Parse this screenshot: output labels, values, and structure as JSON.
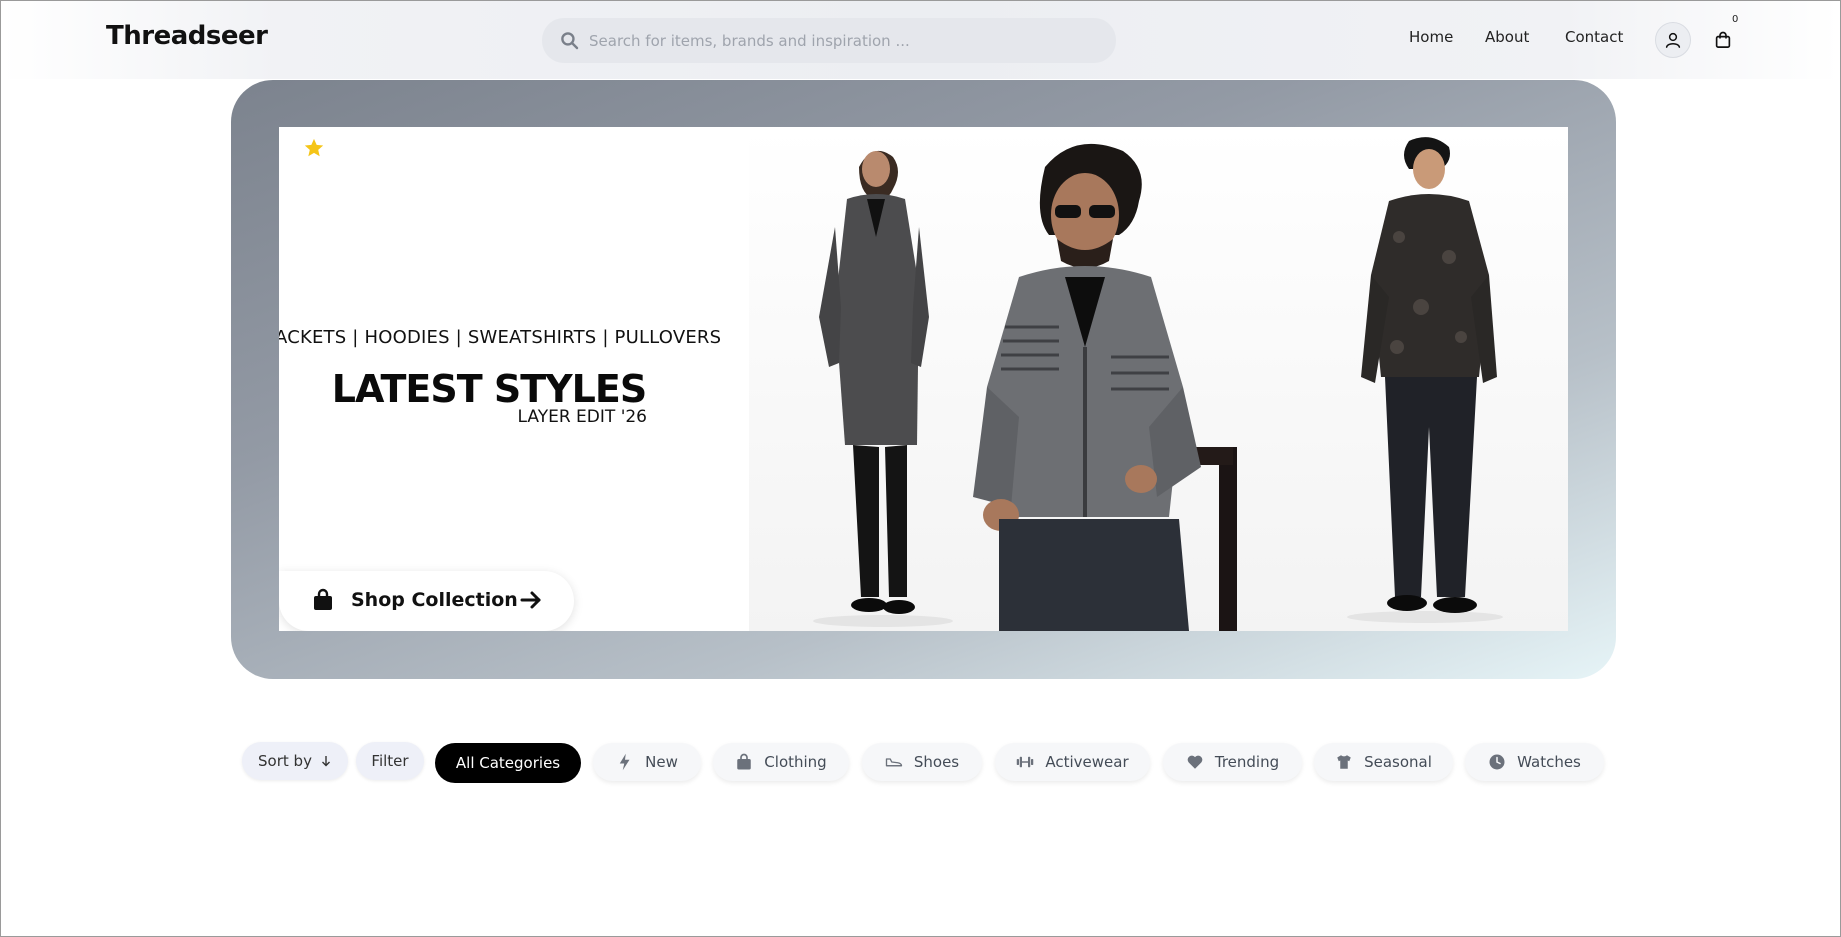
{
  "header": {
    "brand": "Threadseer",
    "search_placeholder": "Search for items, brands and inspiration ...",
    "nav": [
      "Home",
      "About",
      "Contact"
    ],
    "cart_count": "0"
  },
  "hero": {
    "categories_line": "ACKETS | HOODIES | SWEATSHIRTS | PULLOVERS",
    "title": "LATEST STYLES",
    "subtitle": "LAYER EDIT '26",
    "cta_label": "Shop Collection"
  },
  "filters": {
    "sort_label": "Sort by",
    "filter_label": "Filter",
    "categories": [
      {
        "label": "All Categories",
        "icon": "none",
        "active": true
      },
      {
        "label": "New",
        "icon": "bolt-icon"
      },
      {
        "label": "Clothing",
        "icon": "bag-icon"
      },
      {
        "label": "Shoes",
        "icon": "shoe-icon"
      },
      {
        "label": "Activewear",
        "icon": "dumbbell-icon"
      },
      {
        "label": "Trending",
        "icon": "heart-icon"
      },
      {
        "label": "Seasonal",
        "icon": "tshirt-icon"
      },
      {
        "label": "Watches",
        "icon": "clock-icon"
      }
    ]
  },
  "colors": {
    "accent": "#000000",
    "star": "#f5c518",
    "chip_text": "#444c57"
  }
}
